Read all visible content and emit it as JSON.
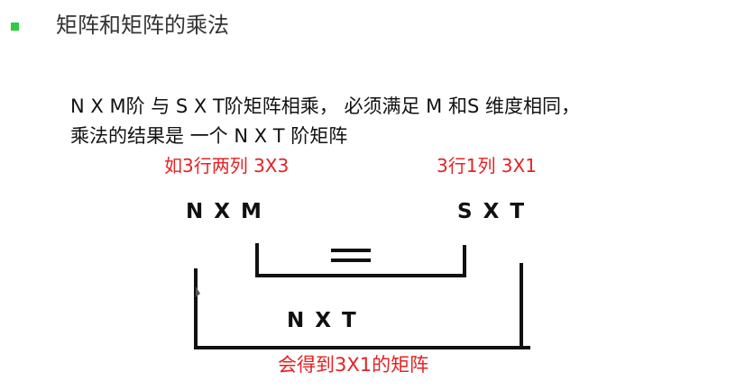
{
  "title": "矩阵和矩阵的乘法",
  "body": {
    "line1": "N X M阶 与  S X T阶矩阵相乘，  必须满足 M 和S 维度相同，",
    "line2": "乘法的结果是 一个 N X T 阶矩阵"
  },
  "diagram": {
    "left_annotation": "如3行两列 3X3",
    "right_annotation": "3行1列 3X1",
    "left_matrix": "N X  M",
    "right_matrix": "S X  T",
    "equals_sign": "=",
    "result_matrix": "N X T",
    "bottom_annotation": "会得到3X1的矩阵"
  },
  "colors": {
    "bullet": "#2ecc40",
    "annotation": "#e52222",
    "text": "#111111"
  }
}
